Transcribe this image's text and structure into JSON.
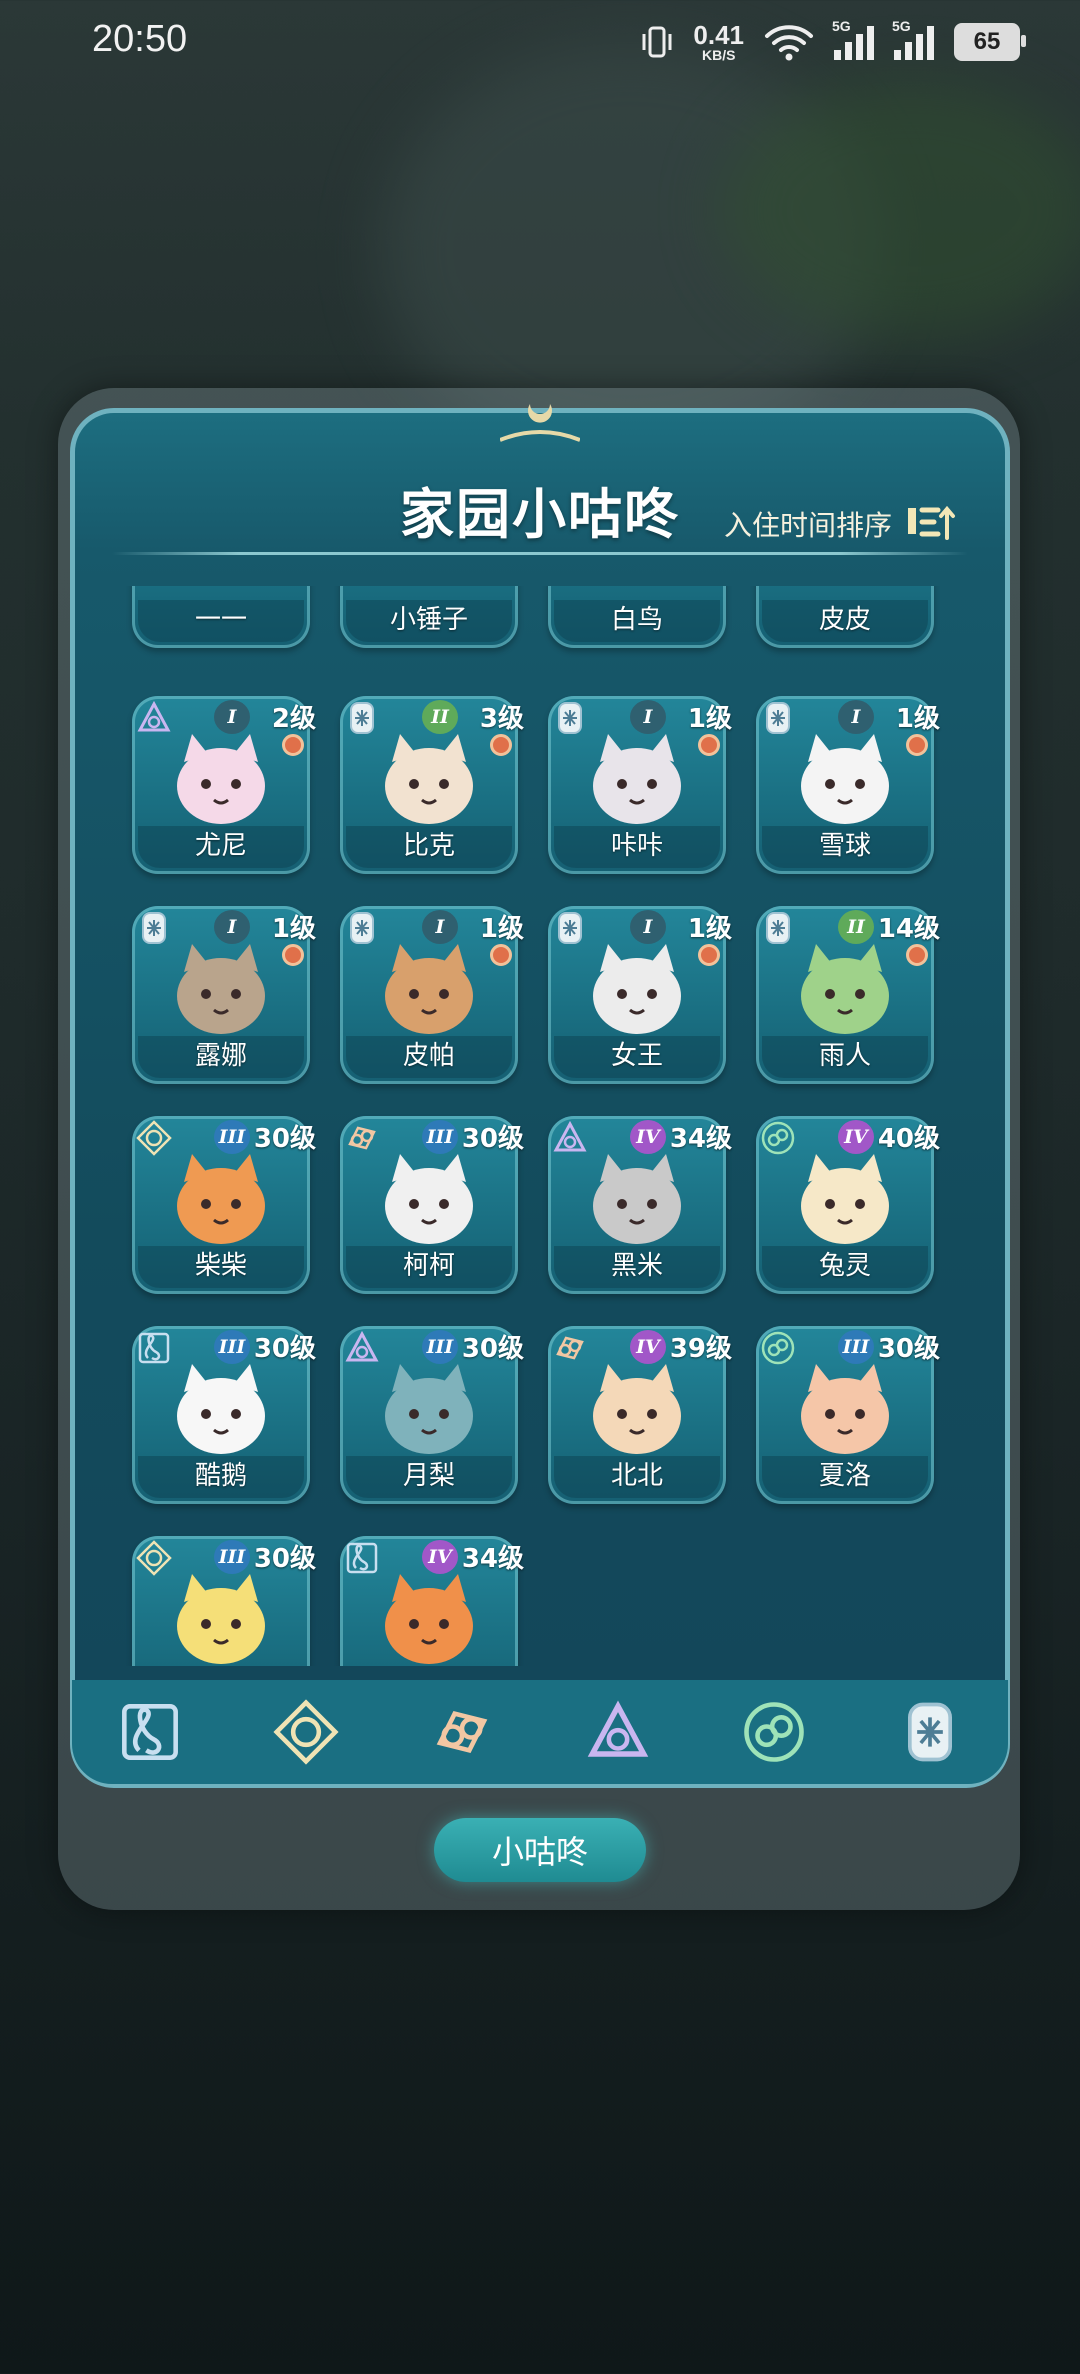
{
  "status_bar": {
    "time": "20:50",
    "net_speed": "0.41",
    "net_unit": "KB/S",
    "sig1": "5G",
    "sig2": "5G",
    "battery": "65"
  },
  "panel": {
    "title": "家园小咕咚",
    "sort_label": "入住时间排序"
  },
  "partial_row": [
    "一一",
    "小锤子",
    "白鸟",
    "皮皮"
  ],
  "cards": [
    {
      "name": "尤尼",
      "rank": "I",
      "level": "2级",
      "faction": "triangle-faction-icon",
      "dot": true
    },
    {
      "name": "比克",
      "rank": "II",
      "level": "3级",
      "faction": "shield-faction-icon",
      "dot": true
    },
    {
      "name": "咔咔",
      "rank": "I",
      "level": "1级",
      "faction": "shield-faction-icon",
      "dot": true
    },
    {
      "name": "雪球",
      "rank": "I",
      "level": "1级",
      "faction": "shield-faction-icon",
      "dot": true
    },
    {
      "name": "露娜",
      "rank": "I",
      "level": "1级",
      "faction": "shield-faction-icon",
      "dot": true
    },
    {
      "name": "皮帕",
      "rank": "I",
      "level": "1级",
      "faction": "shield-faction-icon",
      "dot": true
    },
    {
      "name": "女王",
      "rank": "I",
      "level": "1级",
      "faction": "shield-faction-icon",
      "dot": true
    },
    {
      "name": "雨人",
      "rank": "II",
      "level": "14级",
      "faction": "shield-faction-icon",
      "dot": true
    },
    {
      "name": "柴柴",
      "rank": "III",
      "level": "30级",
      "faction": "sun-faction-icon",
      "dot": false
    },
    {
      "name": "柯柯",
      "rank": "III",
      "level": "30级",
      "faction": "link-faction-icon",
      "dot": false
    },
    {
      "name": "黑米",
      "rank": "IV",
      "level": "34级",
      "faction": "triangle-faction-icon",
      "dot": false
    },
    {
      "name": "兔灵",
      "rank": "IV",
      "level": "40级",
      "faction": "knot-faction-icon",
      "dot": false
    },
    {
      "name": "酷鹅",
      "rank": "III",
      "level": "30级",
      "faction": "clef-faction-icon",
      "dot": false
    },
    {
      "name": "月梨",
      "rank": "III",
      "level": "30级",
      "faction": "triangle-faction-icon",
      "dot": false
    },
    {
      "name": "北北",
      "rank": "IV",
      "level": "39级",
      "faction": "link-faction-icon",
      "dot": false
    },
    {
      "name": "夏洛",
      "rank": "III",
      "level": "30级",
      "faction": "knot-faction-icon",
      "dot": false
    },
    {
      "name": "",
      "rank": "III",
      "level": "30级",
      "faction": "sun-faction-icon",
      "dot": false
    },
    {
      "name": "",
      "rank": "IV",
      "level": "34级",
      "faction": "clef-faction-icon",
      "dot": false
    }
  ],
  "tabs": [
    "clef-faction-icon",
    "sun-faction-icon",
    "link-faction-icon",
    "triangle-faction-icon",
    "knot-faction-icon",
    "shield-faction-icon"
  ],
  "bottom_button": "小咕咚",
  "colors": {
    "accent": "#1a6f82",
    "dot": "#e0704a",
    "rank_iv": "#a157c8",
    "rank_iii": "#2e7ab8",
    "rank_ii": "#5faa5a"
  }
}
